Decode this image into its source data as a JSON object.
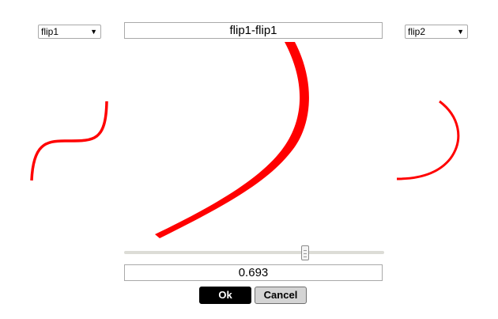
{
  "left_select": {
    "value": "flip1",
    "arrow": "▼"
  },
  "right_select": {
    "value": "flip2",
    "arrow": "▼"
  },
  "title_field": {
    "value": "flip1-flip1"
  },
  "slider": {
    "value_fraction": 0.693
  },
  "value_field": {
    "value": "0.693"
  },
  "buttons": {
    "ok_label": "Ok",
    "cancel_label": "Cancel"
  },
  "colors": {
    "curve": "#ff0000",
    "ok_bg": "#000000",
    "cancel_bg": "#d4d4d4"
  }
}
